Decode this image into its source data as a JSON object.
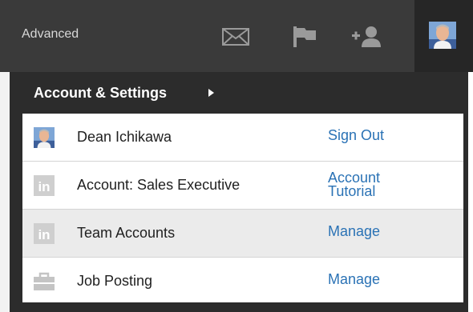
{
  "topbar": {
    "advanced_label": "Advanced",
    "icons": [
      "mail-icon",
      "flag-icon",
      "add-connection-icon",
      "avatar"
    ]
  },
  "dropdown": {
    "title": "Account & Settings",
    "rows": [
      {
        "label": "Dean Ichikawa",
        "action": "Sign Out",
        "icon": "avatar"
      },
      {
        "label": "Account: Sales Executive",
        "action_line1": "Account",
        "action_line2": "Tutorial",
        "icon": "linkedin-icon"
      },
      {
        "label": "Team Accounts",
        "action": "Manage",
        "icon": "linkedin-icon"
      },
      {
        "label": "Job Posting",
        "action": "Manage",
        "icon": "briefcase-icon"
      }
    ]
  },
  "colors": {
    "topbar_bg": "#3a3a3a",
    "dropdown_bg": "#2c2c2c",
    "link": "#2a72b5",
    "highlight_row": "#ebebeb"
  }
}
